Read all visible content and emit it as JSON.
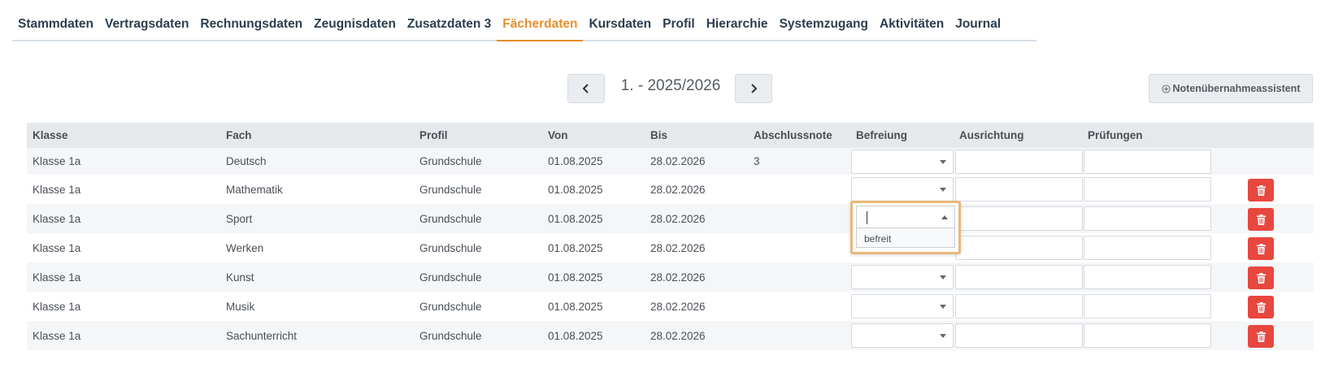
{
  "tabs": [
    {
      "label": "Stammdaten"
    },
    {
      "label": "Vertragsdaten"
    },
    {
      "label": "Rechnungsdaten"
    },
    {
      "label": "Zeugnisdaten"
    },
    {
      "label": "Zusatzdaten 3"
    },
    {
      "label": "Fächerdaten",
      "active": true
    },
    {
      "label": "Kursdaten"
    },
    {
      "label": "Profil"
    },
    {
      "label": "Hierarchie"
    },
    {
      "label": "Systemzugang"
    },
    {
      "label": "Aktivitäten"
    },
    {
      "label": "Journal"
    }
  ],
  "period": {
    "label": "1. - 2025/2026",
    "prev_icon": "chevron-left-icon",
    "next_icon": "chevron-right-icon"
  },
  "assistant_button": {
    "label": "Notenübernahmeassistent",
    "icon": "plus-circle-icon"
  },
  "table": {
    "columns": [
      "Klasse",
      "Fach",
      "Profil",
      "Von",
      "Bis",
      "Abschlussnote",
      "Befreiung",
      "Ausrichtung",
      "Prüfungen"
    ],
    "rows": [
      {
        "klasse": "Klasse 1a",
        "fach": "Deutsch",
        "profil": "Grundschule",
        "von": "01.08.2025",
        "bis": "28.02.2026",
        "note": "3",
        "deletable": false
      },
      {
        "klasse": "Klasse 1a",
        "fach": "Mathematik",
        "profil": "Grundschule",
        "von": "01.08.2025",
        "bis": "28.02.2026",
        "note": "",
        "deletable": true
      },
      {
        "klasse": "Klasse 1a",
        "fach": "Sport",
        "profil": "Grundschule",
        "von": "01.08.2025",
        "bis": "28.02.2026",
        "note": "",
        "deletable": true
      },
      {
        "klasse": "Klasse 1a",
        "fach": "Werken",
        "profil": "Grundschule",
        "von": "01.08.2025",
        "bis": "28.02.2026",
        "note": "",
        "deletable": true
      },
      {
        "klasse": "Klasse 1a",
        "fach": "Kunst",
        "profil": "Grundschule",
        "von": "01.08.2025",
        "bis": "28.02.2026",
        "note": "",
        "deletable": true
      },
      {
        "klasse": "Klasse 1a",
        "fach": "Musik",
        "profil": "Grundschule",
        "von": "01.08.2025",
        "bis": "28.02.2026",
        "note": "",
        "deletable": true
      },
      {
        "klasse": "Klasse 1a",
        "fach": "Sachunterricht",
        "profil": "Grundschule",
        "von": "01.08.2025",
        "bis": "28.02.2026",
        "note": "",
        "deletable": true
      }
    ]
  },
  "open_dropdown": {
    "row": "Sport",
    "value": "",
    "options": [
      "befreit"
    ]
  },
  "colors": {
    "accent": "#e88e2a",
    "tab_text": "#2c3e50",
    "delete": "#e8473f",
    "header_bg": "#e6e9ec",
    "focus_ring": "#e8b879"
  }
}
